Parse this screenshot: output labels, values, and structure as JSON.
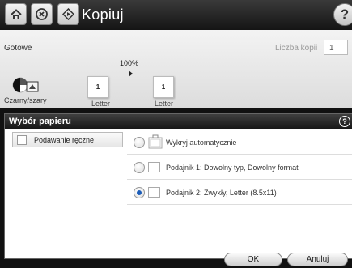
{
  "header": {
    "title": "Kopiuj",
    "help_label": "?"
  },
  "status": {
    "state": "Gotowe",
    "copies_label": "Liczba kopii",
    "copies_value": "1",
    "scale": "100%",
    "source_sheet": "1",
    "source_paper": "Letter",
    "output_sheet": "1",
    "output_paper": "Letter",
    "color_mode": "Czarny/szary"
  },
  "dialog": {
    "title": "Wybór papieru",
    "help_label": "?",
    "manual_feed_label": "Podawanie ręczne",
    "options": [
      {
        "label": "Wykryj automatycznie",
        "selected": false
      },
      {
        "label": "Podajnik 1: Dowolny typ, Dowolny format",
        "selected": false
      },
      {
        "label": "Podajnik 2: Zwykły, Letter (8.5x11)",
        "selected": true
      }
    ]
  },
  "buttons": {
    "ok": "OK",
    "cancel": "Anuluj"
  },
  "colors": {
    "accent": "#1c5db8",
    "header_bg": "#222222"
  }
}
